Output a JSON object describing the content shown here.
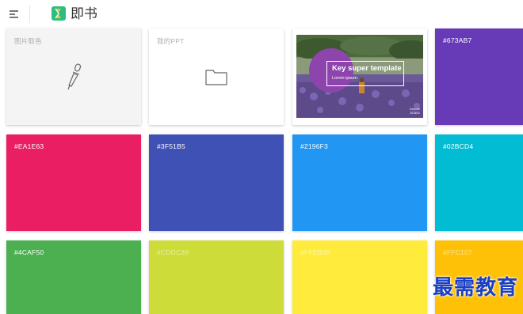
{
  "app": {
    "name": "即书"
  },
  "tools": [
    {
      "label": "图片取色",
      "icon": "eyedropper-icon"
    },
    {
      "label": "我的PPT",
      "icon": "folder-icon"
    }
  ],
  "template": {
    "title": "Key super template",
    "subtitle": "Lorem ipsum",
    "footer_line1": "Keynote",
    "footer_line2": "2018/01"
  },
  "swatches": [
    {
      "label": "#673AB7",
      "color": "#673AB7"
    },
    {
      "label": "#EA1E63",
      "color": "#EA1E63"
    },
    {
      "label": "#3F51B5",
      "color": "#3F51B5"
    },
    {
      "label": "#2196F3",
      "color": "#2196F3"
    },
    {
      "label": "#02BCD4",
      "color": "#02BCD4"
    },
    {
      "label": "#4CAF50",
      "color": "#4CAF50"
    },
    {
      "label": "#CDDC39",
      "color": "#CDDC39"
    },
    {
      "label": "#FFEB3B",
      "color": "#FFEB3B"
    },
    {
      "label": "#FFC107",
      "color": "#FFC107"
    }
  ],
  "colors": {
    "brand_green": "#2DBE7E",
    "brand_yellow": "#F2C53D",
    "template_accent": "#8E44AD"
  },
  "watermark": "最需教育"
}
